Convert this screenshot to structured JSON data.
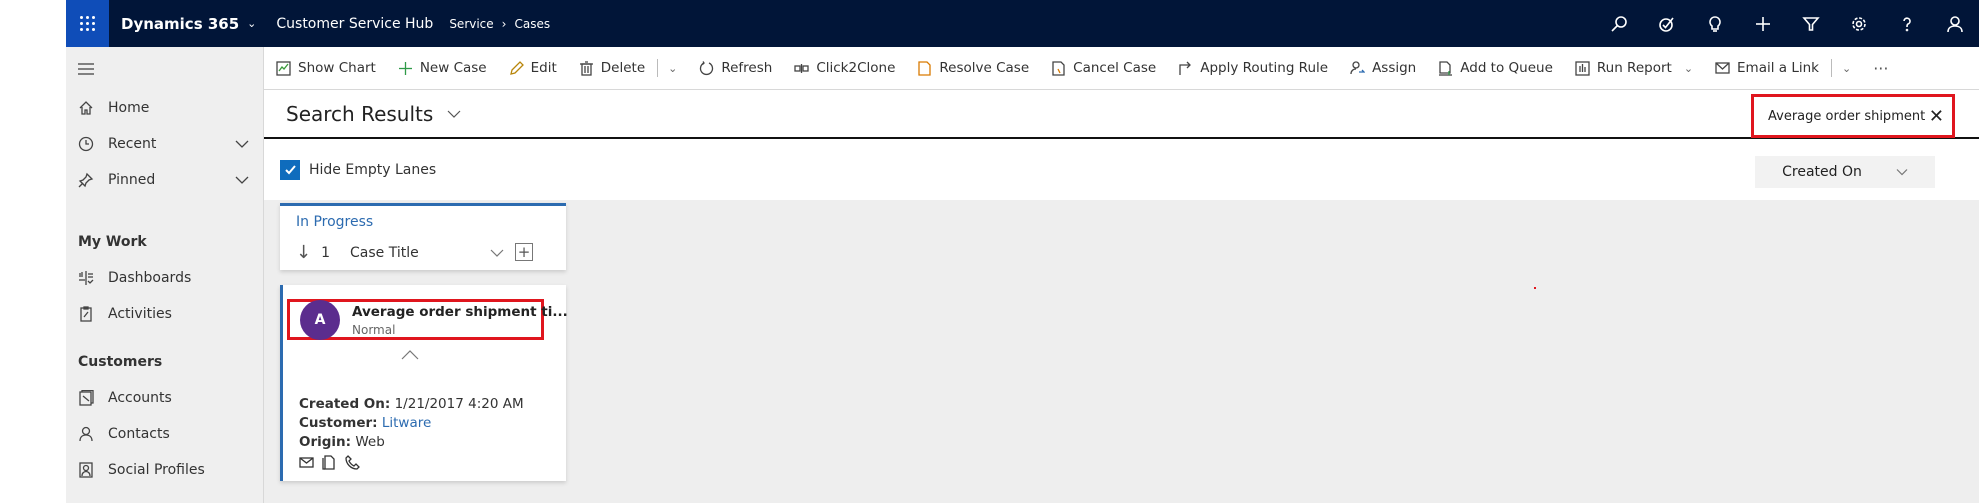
{
  "topbar": {
    "brand": "Dynamics 365",
    "app_name": "Customer Service Hub",
    "breadcrumb": [
      "Service",
      "Cases"
    ],
    "icons": [
      "search-icon",
      "task-flow-icon",
      "lightbulb-icon",
      "plus-icon",
      "filter-icon",
      "gear-icon",
      "help-icon",
      "user-icon"
    ]
  },
  "sidebar": {
    "items": [
      {
        "label": "Home",
        "icon": "home-icon"
      },
      {
        "label": "Recent",
        "icon": "clock-icon",
        "expandable": true
      },
      {
        "label": "Pinned",
        "icon": "pin-icon",
        "expandable": true
      }
    ],
    "groups": [
      {
        "title": "My Work",
        "items": [
          {
            "label": "Dashboards",
            "icon": "dashboard-icon"
          },
          {
            "label": "Activities",
            "icon": "clipboard-icon"
          }
        ]
      },
      {
        "title": "Customers",
        "items": [
          {
            "label": "Accounts",
            "icon": "accounts-icon"
          },
          {
            "label": "Contacts",
            "icon": "contact-icon"
          },
          {
            "label": "Social Profiles",
            "icon": "social-profile-icon"
          }
        ]
      }
    ]
  },
  "toolbar": {
    "buttons": [
      "Show Chart",
      "New Case",
      "Edit",
      "Delete",
      "Refresh",
      "Click2Clone",
      "Resolve Case",
      "Cancel Case",
      "Apply Routing Rule",
      "Assign",
      "Add to Queue",
      "Run Report",
      "Email a Link"
    ],
    "more": "···"
  },
  "view": {
    "title": "Search Results",
    "search_value": "Average order shipment",
    "clear_icon": "✕"
  },
  "lanes": {
    "hide_empty_label": "Hide Empty Lanes",
    "hide_empty_checked": true,
    "sort_by": "Created On"
  },
  "lane": {
    "title": "In Progress",
    "count": "1",
    "sort_field": "Case Title",
    "add_icon": "+"
  },
  "card": {
    "avatar_initial": "A",
    "title": "Average order shipment ti...",
    "priority": "Normal",
    "created_on_label": "Created On:",
    "created_on_value": "1/21/2017 4:20 AM",
    "customer_label": "Customer:",
    "customer_value": "Litware",
    "origin_label": "Origin:",
    "origin_value": "Web",
    "action_icons": [
      "email-icon",
      "document-icon",
      "phone-icon"
    ]
  },
  "colors": {
    "topbar": "#011538",
    "waffle": "#0f4db8",
    "accent": "#2c6bb0",
    "avatar": "#5b2d8e",
    "highlight": "#e0161e"
  }
}
